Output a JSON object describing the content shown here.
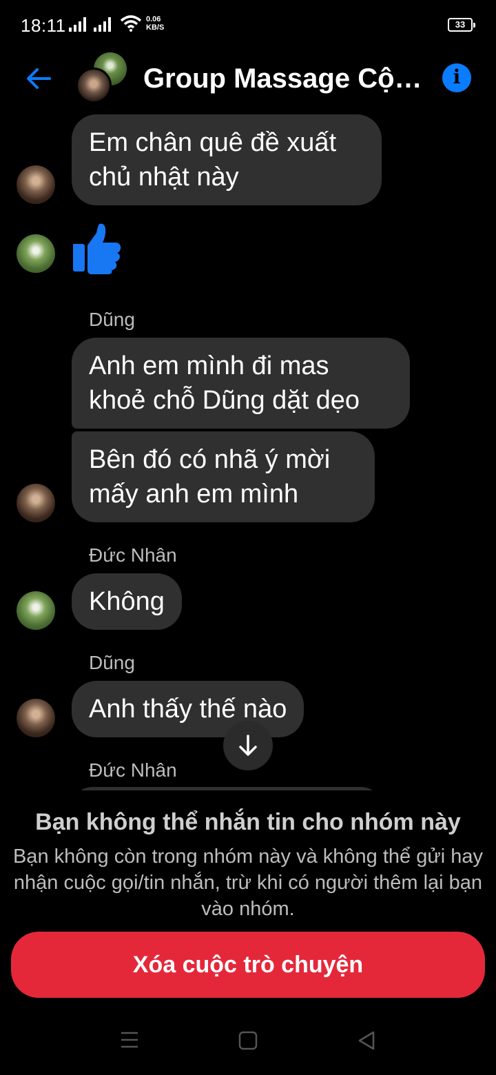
{
  "status_bar": {
    "time": "18:11",
    "net_speed_value": "0.06",
    "net_speed_unit": "KB/S",
    "battery": "33"
  },
  "header": {
    "title": "Group Massage Cộ…",
    "info_glyph": "i"
  },
  "messages": [
    {
      "sender": "",
      "text": "Em chân quê đề xuất chủ nhật này"
    },
    {
      "sender": "",
      "type": "like"
    },
    {
      "sender": "Dũng",
      "text": "Anh em mình đi mas khoẻ chỗ Dũng dặt dẹo"
    },
    {
      "sender": "",
      "text": "Bên đó có nhã ý mời mấy anh em mình"
    },
    {
      "sender": "Đức Nhân",
      "text": "Không"
    },
    {
      "sender": "Dũng",
      "text": "Anh thấy thế nào"
    },
    {
      "sender": "Đức Nhân",
      "text": ""
    }
  ],
  "notice": {
    "title": "Bạn không thể nhắn tin cho nhóm này",
    "body": "Bạn không còn trong nhóm này và không thể gửi hay nhận cuộc gọi/tin nhắn, trừ khi có người thêm lại bạn vào nhóm.",
    "delete_label": "Xóa cuộc trò chuyện"
  },
  "colors": {
    "accent": "#0a7cff",
    "bubble": "#303030",
    "danger": "#e4283a"
  },
  "icons": [
    "back-arrow-icon",
    "info-icon",
    "like-icon",
    "arrow-down-icon",
    "menu-icon",
    "home-icon",
    "back-icon"
  ]
}
